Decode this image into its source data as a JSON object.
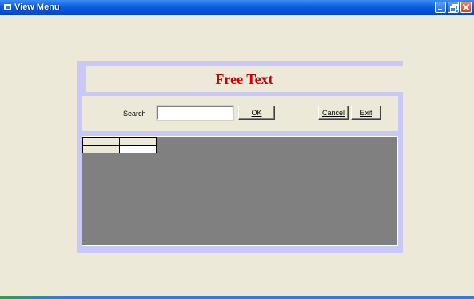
{
  "window": {
    "title": "View Menu",
    "controls": {
      "minimize": "minimize-icon",
      "maximize": "restore-icon",
      "close": "close-icon"
    }
  },
  "header": {
    "title": "Free Text",
    "title_color": "#cc0000"
  },
  "search": {
    "label": "Search",
    "value": "",
    "ok_label": "OK",
    "cancel_label": "Cancel",
    "exit_label": "Exit"
  },
  "grid": {
    "rows": [
      [
        "",
        ""
      ],
      [
        "",
        ""
      ]
    ]
  },
  "colors": {
    "panel_border": "#c9c9f7",
    "grid_background": "#808080",
    "window_background": "#ece9d8"
  }
}
